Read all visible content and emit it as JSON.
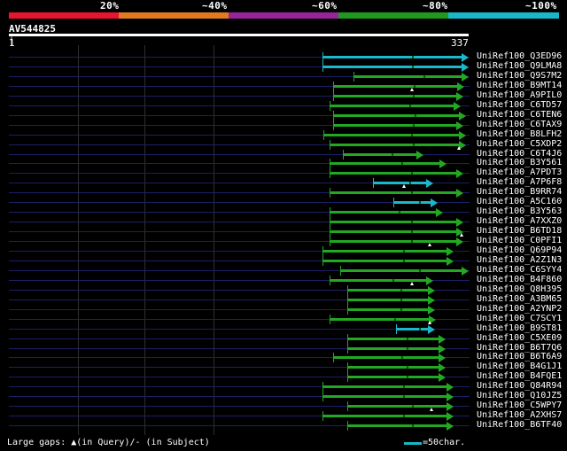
{
  "coverage": {
    "labels": [
      "20%",
      "~40%",
      "~60%",
      "~80%",
      "~100%"
    ],
    "bands": [
      {
        "color": "#e8152e"
      },
      {
        "color": "#e07a1e"
      },
      {
        "color": "#98249c"
      },
      {
        "color": "#1f9a1f"
      },
      {
        "color": "#18b8c8"
      }
    ]
  },
  "query": {
    "name": "AV544825",
    "start": "1",
    "end": "337"
  },
  "colors": {
    "green": "#23a823",
    "cyan": "#1ab8cc",
    "row_line": "#1d1f66"
  },
  "hits": [
    {
      "name": "UniRef100_Q3ED96",
      "start": 231,
      "end": 337,
      "color": "cyan"
    },
    {
      "name": "UniRef100_Q9LMA8",
      "start": 231,
      "end": 337,
      "color": "cyan"
    },
    {
      "name": "UniRef100_Q9S7M2",
      "start": 254,
      "end": 337,
      "color": "green"
    },
    {
      "name": "UniRef100_B9MT14",
      "start": 239,
      "end": 334,
      "color": "green"
    },
    {
      "name": "UniRef100_A9PIL0",
      "start": 239,
      "end": 333,
      "color": "green"
    },
    {
      "name": "UniRef100_C6TD57",
      "start": 236,
      "end": 331,
      "color": "green"
    },
    {
      "name": "UniRef100_C6TEN6",
      "start": 239,
      "end": 335,
      "color": "green"
    },
    {
      "name": "UniRef100_C6TAX9",
      "start": 239,
      "end": 333,
      "color": "green"
    },
    {
      "name": "UniRef100_B8LFH2",
      "start": 232,
      "end": 335,
      "color": "green"
    },
    {
      "name": "UniRef100_C5XDP2",
      "start": 236,
      "end": 335,
      "color": "green"
    },
    {
      "name": "UniRef100_C6T4J6",
      "start": 246,
      "end": 304,
      "color": "green"
    },
    {
      "name": "UniRef100_B3Y561",
      "start": 236,
      "end": 321,
      "color": "green"
    },
    {
      "name": "UniRef100_A7PDT3",
      "start": 236,
      "end": 333,
      "color": "green"
    },
    {
      "name": "UniRef100_A7P6F8",
      "start": 268,
      "end": 311,
      "color": "cyan"
    },
    {
      "name": "UniRef100_B9RR74",
      "start": 236,
      "end": 333,
      "color": "green"
    },
    {
      "name": "UniRef100_A5C160",
      "start": 283,
      "end": 314,
      "color": "cyan"
    },
    {
      "name": "UniRef100_B3Y563",
      "start": 236,
      "end": 318,
      "color": "green"
    },
    {
      "name": "UniRef100_A7XXZ0",
      "start": 236,
      "end": 333,
      "color": "green"
    },
    {
      "name": "UniRef100_B6TD18",
      "start": 236,
      "end": 333,
      "color": "green"
    },
    {
      "name": "UniRef100_C0PFI1",
      "start": 236,
      "end": 333,
      "color": "green"
    },
    {
      "name": "UniRef100_Q69P94",
      "start": 231,
      "end": 326,
      "color": "green"
    },
    {
      "name": "UniRef100_A2Z1N3",
      "start": 231,
      "end": 326,
      "color": "green"
    },
    {
      "name": "UniRef100_C6SYY4",
      "start": 244,
      "end": 337,
      "color": "green"
    },
    {
      "name": "UniRef100_B4F860",
      "start": 236,
      "end": 311,
      "color": "green"
    },
    {
      "name": "UniRef100_Q8H395",
      "start": 249,
      "end": 312,
      "color": "green"
    },
    {
      "name": "UniRef100_A3BM65",
      "start": 249,
      "end": 312,
      "color": "green"
    },
    {
      "name": "UniRef100_A2YNP2",
      "start": 249,
      "end": 312,
      "color": "green"
    },
    {
      "name": "UniRef100_C7SCY1",
      "start": 236,
      "end": 313,
      "color": "green"
    },
    {
      "name": "UniRef100_B9ST81",
      "start": 285,
      "end": 312,
      "color": "cyan"
    },
    {
      "name": "UniRef100_C5XE09",
      "start": 249,
      "end": 320,
      "color": "green"
    },
    {
      "name": "UniRef100_B6T7Q6",
      "start": 249,
      "end": 320,
      "color": "green"
    },
    {
      "name": "UniRef100_B6T6A9",
      "start": 239,
      "end": 320,
      "color": "green"
    },
    {
      "name": "UniRef100_B4G1J1",
      "start": 249,
      "end": 320,
      "color": "green"
    },
    {
      "name": "UniRef100_B4FQE1",
      "start": 249,
      "end": 320,
      "color": "green"
    },
    {
      "name": "UniRef100_Q84R94",
      "start": 231,
      "end": 326,
      "color": "green"
    },
    {
      "name": "UniRef100_Q10JZ5",
      "start": 231,
      "end": 326,
      "color": "green"
    },
    {
      "name": "UniRef100_C5WPY7",
      "start": 249,
      "end": 326,
      "color": "green"
    },
    {
      "name": "UniRef100_A2XHS7",
      "start": 231,
      "end": 326,
      "color": "green"
    },
    {
      "name": "UniRef100_B6TF40",
      "start": 249,
      "end": 326,
      "color": "green"
    }
  ],
  "gap_markers": [
    {
      "row": 3,
      "pos": 297
    },
    {
      "row": 9,
      "pos": 331
    },
    {
      "row": 13,
      "pos": 291
    },
    {
      "row": 18,
      "pos": 333
    },
    {
      "row": 19,
      "pos": 310
    },
    {
      "row": 23,
      "pos": 297
    },
    {
      "row": 27,
      "pos": 310
    },
    {
      "row": 36,
      "pos": 311
    }
  ],
  "legend": {
    "gaps_text": "Large gaps: ▲(in Query)/- (in Subject)",
    "scale_text": "=50char."
  }
}
